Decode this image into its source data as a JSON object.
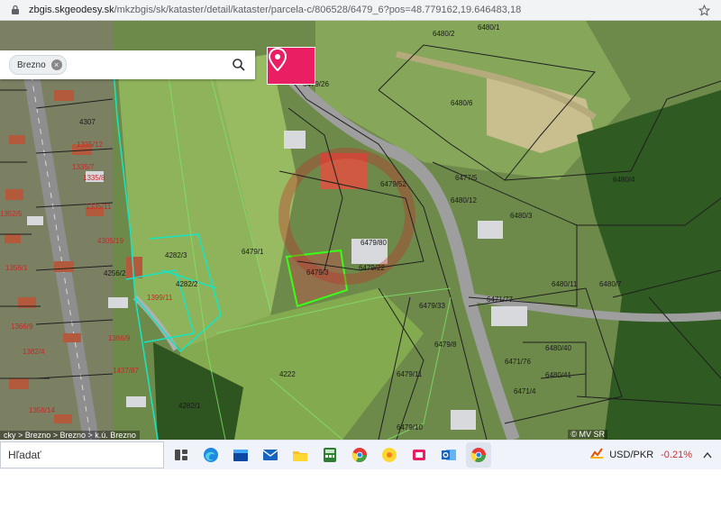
{
  "browser": {
    "url_host": "zbgis.skgeodesy.sk",
    "url_path": "/mkzbgis/sk/kataster/detail/kataster/parcela-c/806528/6479_6?pos=48.779162,19.646483,18"
  },
  "search": {
    "chip_label": "Brezno",
    "chip_remove": "×"
  },
  "parcel_labels": [
    {
      "text": "6480/1"
    },
    {
      "text": "6480/2"
    },
    {
      "text": "6480/6"
    },
    {
      "text": "6479/26"
    },
    {
      "text": "6479/52"
    },
    {
      "text": "6479/1"
    },
    {
      "text": "6479/3"
    },
    {
      "text": "6479/80"
    },
    {
      "text": "6479/22"
    },
    {
      "text": "6479/33"
    },
    {
      "text": "6479/8"
    },
    {
      "text": "6479/11"
    },
    {
      "text": "6479/10"
    },
    {
      "text": "6480/12"
    },
    {
      "text": "6480/3"
    },
    {
      "text": "6480/4"
    },
    {
      "text": "6480/11"
    },
    {
      "text": "6480/7"
    },
    {
      "text": "6480/40"
    },
    {
      "text": "6471/76"
    },
    {
      "text": "6471/4"
    },
    {
      "text": "6480/41"
    },
    {
      "text": "4307"
    },
    {
      "text": "4282/3"
    },
    {
      "text": "4282/2"
    },
    {
      "text": "4282/1"
    },
    {
      "text": "4256/2"
    },
    {
      "text": "4222"
    },
    {
      "text": "6477/5"
    },
    {
      "text": "6471/77"
    }
  ],
  "building_labels": [
    {
      "text": "1335/12"
    },
    {
      "text": "1335/7"
    },
    {
      "text": "1335/8"
    },
    {
      "text": "1352/5"
    },
    {
      "text": "1335/11"
    },
    {
      "text": "4305/19"
    },
    {
      "text": "1356/1"
    },
    {
      "text": "1366/9"
    },
    {
      "text": "1382/4"
    },
    {
      "text": "1366/9"
    },
    {
      "text": "1437/87"
    },
    {
      "text": "1356/14"
    },
    {
      "text": "1399/11"
    }
  ],
  "map_attribution": "© MV SR",
  "breadcrumb": "cky > Brezno > Brezno > k.ú. Brezno",
  "taskbar": {
    "search_placeholder": "Hľadať",
    "apps": [
      "widgets-icon",
      "edge-icon",
      "store-icon",
      "explorer-icon",
      "calculator-icon",
      "chrome-icon",
      "photos-icon",
      "outlook-icon",
      "chrome-active-icon"
    ],
    "currency_pair": "USD/PKR",
    "currency_change": "-0.21%"
  },
  "colors": {
    "accent_pink": "#e91e63",
    "parcel_line": "#1f1f1f",
    "highlight_green": "#39ff14",
    "cyan_border": "#19e3c0",
    "negative": "#d32f2f"
  }
}
